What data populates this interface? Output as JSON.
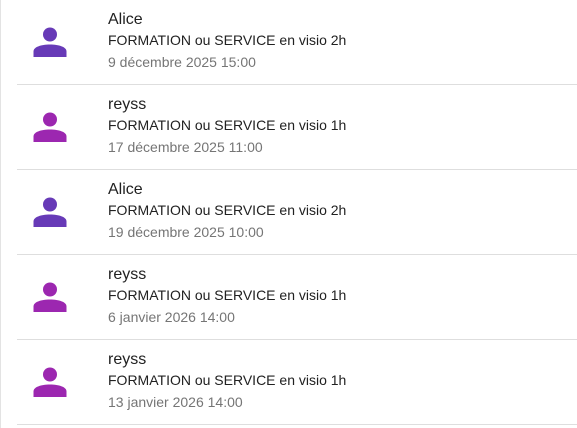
{
  "appointments": [
    {
      "name": "Alice",
      "description": "FORMATION ou SERVICE en visio 2h",
      "date": "9 décembre 2025 15:00",
      "icon": "person-icon",
      "color": "#673ab7"
    },
    {
      "name": "reyss",
      "description": "FORMATION ou SERVICE en visio 1h",
      "date": "17 décembre 2025 11:00",
      "icon": "person-icon",
      "color": "#9c27b0"
    },
    {
      "name": "Alice",
      "description": "FORMATION ou SERVICE en visio 2h",
      "date": "19 décembre 2025 10:00",
      "icon": "person-icon",
      "color": "#673ab7"
    },
    {
      "name": "reyss",
      "description": "FORMATION ou SERVICE en visio 1h",
      "date": "6 janvier 2026 14:00",
      "icon": "person-icon",
      "color": "#9c27b0"
    },
    {
      "name": "reyss",
      "description": "FORMATION ou SERVICE en visio 1h",
      "date": "13 janvier 2026 14:00",
      "icon": "person-icon",
      "color": "#9c27b0"
    }
  ]
}
